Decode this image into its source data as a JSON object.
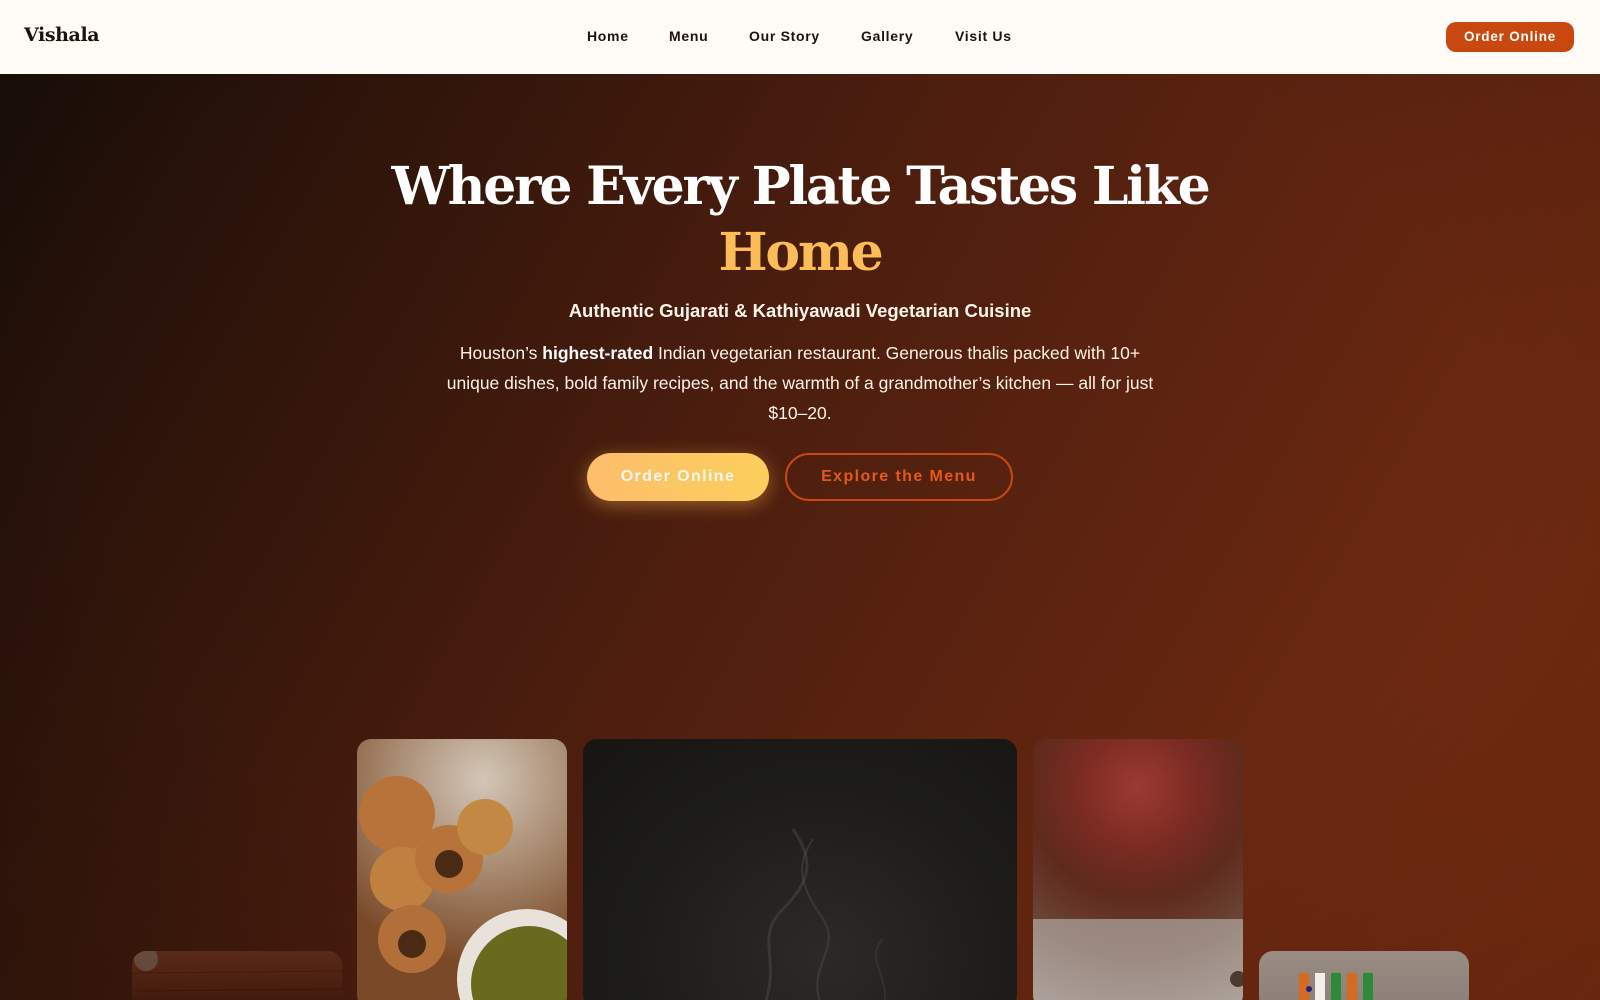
{
  "header": {
    "logo": "Vishala",
    "nav": [
      {
        "label": "Home"
      },
      {
        "label": "Menu"
      },
      {
        "label": "Our Story"
      },
      {
        "label": "Gallery"
      },
      {
        "label": "Visit Us"
      }
    ],
    "cta_label": "Order Online"
  },
  "hero": {
    "title_line1": "Where Every Plate Tastes Like",
    "title_accent": "Home",
    "subtitle": "Authentic Gujarati & Kathiyawadi Vegetarian Cuisine",
    "desc_before": "Houston’s ",
    "desc_bold": "highest-rated",
    "desc_after": " Indian vegetarian restaurant. Generous thalis packed with 10+ unique dishes, bold family recipes, and the warmth of a grandmother’s kitchen — all for just $10–20.",
    "primary_button": "Order Online",
    "secondary_button": "Explore the Menu"
  },
  "colors": {
    "brand_orange": "#c9480f",
    "accent_gold": "#fcbc58",
    "hero_dark": "#1a0e08",
    "hero_rust": "#7a2d10",
    "header_bg": "#fffcf7"
  }
}
